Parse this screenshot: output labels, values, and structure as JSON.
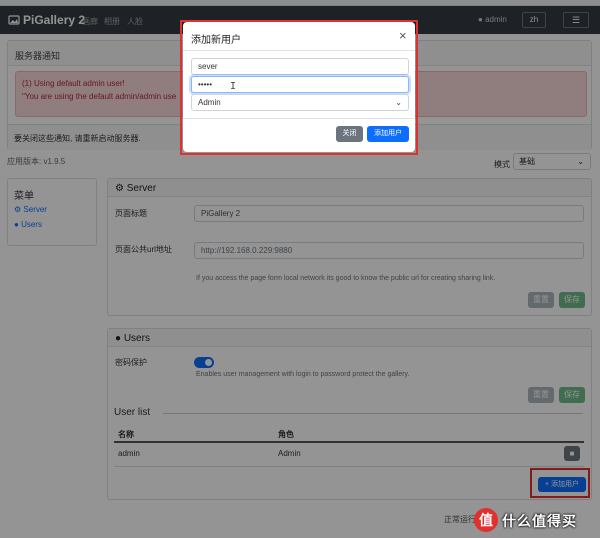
{
  "browser": {
    "bookmarks": [
      "",
      "",
      "",
      "",
      "",
      "",
      "",
      "",
      "",
      "",
      "",
      "",
      "",
      ""
    ]
  },
  "navbar": {
    "brand": "PiGallery 2",
    "links": [
      "画廊",
      "相册",
      "人脸"
    ],
    "user": "admin",
    "lang": "zh",
    "menu_icon": "hamburger-icon"
  },
  "notification": {
    "title": "服务器通知",
    "alert_line1": "(1) Using default admin user!",
    "alert_line2": "\"You are using the default admin/admin use",
    "footer": "要关闭这些通知, 请重新启动服务器."
  },
  "version": "应用版本: v1.9.5",
  "mode": {
    "label": "模式",
    "value": "基础"
  },
  "menu": {
    "title": "菜单",
    "items": [
      "Server",
      "Users"
    ]
  },
  "server": {
    "title": "Server",
    "page_title_label": "页面标题",
    "page_title_value": "PiGallery 2",
    "public_url_label": "页面公共url地址",
    "public_url_value": "http://192.168.0.229:9880",
    "public_url_hint": "If you access the page form local network its good to know the public url for creating sharing link.",
    "reset": "重置",
    "save": "保存"
  },
  "users": {
    "title": "Users",
    "password_label": "密码保护",
    "password_enabled": true,
    "password_hint": "Enables user management with login to password protect the gallery.",
    "reset": "重置",
    "save": "保存",
    "list_title": "User list",
    "col_name": "名称",
    "col_role": "角色",
    "rows": [
      {
        "name": "admin",
        "role": "Admin"
      }
    ],
    "add_user": "+ 添加用户"
  },
  "footer": {
    "status": "正常运行"
  },
  "watermark": {
    "icon": "值",
    "text": "什么值得买"
  },
  "modal": {
    "title": "添加新用户",
    "username": "sever",
    "password_mask": "•••••",
    "role": "Admin",
    "close": "关闭",
    "add": "添加用户"
  },
  "colors": {
    "navbar": "#343a40",
    "primary": "#0d6efd",
    "success": "#6fba8a",
    "alert_bg": "#f8d7da",
    "highlight_outline": "#e03030"
  }
}
